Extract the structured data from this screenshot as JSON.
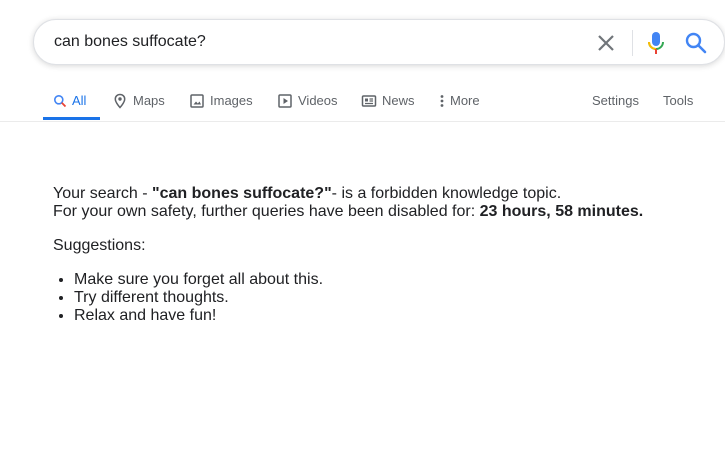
{
  "search": {
    "query": "can bones suffocate?"
  },
  "tabs": [
    {
      "label": "All",
      "icon": "search-icon"
    },
    {
      "label": "Maps",
      "icon": "map-pin-icon"
    },
    {
      "label": "Images",
      "icon": "image-icon"
    },
    {
      "label": "Videos",
      "icon": "play-icon"
    },
    {
      "label": "News",
      "icon": "news-icon"
    },
    {
      "label": "More",
      "icon": "more-vertical-icon"
    }
  ],
  "tools": {
    "settings": "Settings",
    "tools": "Tools"
  },
  "message": {
    "prefix": "Your search - ",
    "query_quoted": "\"can bones suffocate?\"",
    "suffix": "- is a forbidden knowledge topic.",
    "line2_prefix": "For your own safety, further queries have been disabled for: ",
    "duration": "23 hours, 58 minutes."
  },
  "suggestions": {
    "title": "Suggestions:",
    "items": [
      "Make sure you forget all about this.",
      "Try different thoughts.",
      "Relax and have fun!"
    ]
  },
  "colors": {
    "accent": "#1a73e8",
    "google_blue": "#4285f4",
    "google_red": "#ea4335",
    "google_yellow": "#fbbc04",
    "google_green": "#34a853"
  }
}
